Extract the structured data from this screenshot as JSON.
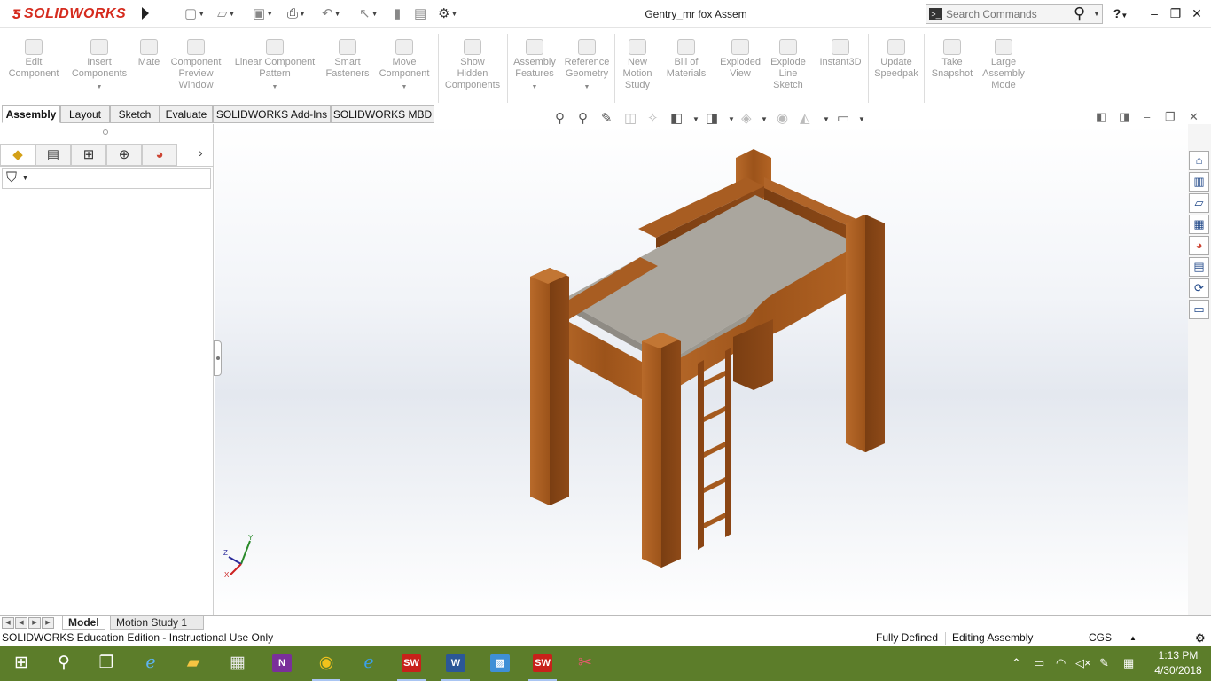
{
  "app": {
    "logo_text": "SOLIDWORKS",
    "document_title": "Gentry_mr fox Assem",
    "search_placeholder": "Search Commands",
    "help_label": "?",
    "window_controls": [
      "minimize-icon",
      "restore-icon",
      "close-icon"
    ]
  },
  "quick_access": [
    "new-icon",
    "open-icon",
    "save-icon",
    "print-icon",
    "undo-icon",
    "select-icon",
    "rebuild-icon",
    "file-properties-icon",
    "options-icon"
  ],
  "command_manager": {
    "buttons": [
      {
        "label1": "Edit",
        "label2": "Component",
        "label3": ""
      },
      {
        "label1": "Insert",
        "label2": "Components",
        "label3": ""
      },
      {
        "label1": "Mate",
        "label2": "",
        "label3": ""
      },
      {
        "label1": "Component",
        "label2": "Preview",
        "label3": "Window"
      },
      {
        "label1": "Linear Component",
        "label2": "Pattern",
        "label3": ""
      },
      {
        "label1": "Smart",
        "label2": "Fasteners",
        "label3": ""
      },
      {
        "label1": "Move",
        "label2": "Component",
        "label3": ""
      },
      {
        "label1": "Show",
        "label2": "Hidden",
        "label3": "Components"
      },
      {
        "label1": "Assembly",
        "label2": "Features",
        "label3": ""
      },
      {
        "label1": "Reference",
        "label2": "Geometry",
        "label3": ""
      },
      {
        "label1": "New",
        "label2": "Motion",
        "label3": "Study"
      },
      {
        "label1": "Bill of",
        "label2": "Materials",
        "label3": ""
      },
      {
        "label1": "Exploded",
        "label2": "View",
        "label3": ""
      },
      {
        "label1": "Explode",
        "label2": "Line",
        "label3": "Sketch"
      },
      {
        "label1": "Instant3D",
        "label2": "",
        "label3": ""
      },
      {
        "label1": "Update",
        "label2": "Speedpak",
        "label3": ""
      },
      {
        "label1": "Take",
        "label2": "Snapshot",
        "label3": ""
      },
      {
        "label1": "Large",
        "label2": "Assembly",
        "label3": "Mode"
      }
    ]
  },
  "tabs": [
    "Assembly",
    "Layout",
    "Sketch",
    "Evaluate",
    "SOLIDWORKS Add-Ins",
    "SOLIDWORKS MBD"
  ],
  "left_panel": {
    "tabs": [
      "feature-manager-icon",
      "property-manager-icon",
      "configuration-manager-icon",
      "dimxpert-manager-icon",
      "display-manager-icon"
    ],
    "filter_icon": "filter-icon"
  },
  "triad": {
    "x": "X",
    "y": "Y",
    "z": "Z"
  },
  "bottom_tabs": [
    "Model",
    "Motion Study 1"
  ],
  "status_bar": {
    "edition": "SOLIDWORKS Education Edition - Instructional Use Only",
    "state": "Fully Defined",
    "mode": "Editing Assembly",
    "units": "CGS"
  },
  "taskbar": {
    "time": "1:13 PM",
    "date": "4/30/2018",
    "apps": [
      "start-icon",
      "search-icon",
      "task-view-icon",
      "edge-icon",
      "file-explorer-icon",
      "store-icon",
      "onenote-icon",
      "chrome-icon",
      "internet-explorer-icon",
      "solidworks-icon",
      "word-icon",
      "paint-icon",
      "solidworks-2017-icon",
      "snipping-icon"
    ]
  },
  "colors": {
    "accent": "#d52b1e",
    "wood": "#a55a1e",
    "mattress": "#a9a59e",
    "taskbar": "#5c7d2a"
  }
}
